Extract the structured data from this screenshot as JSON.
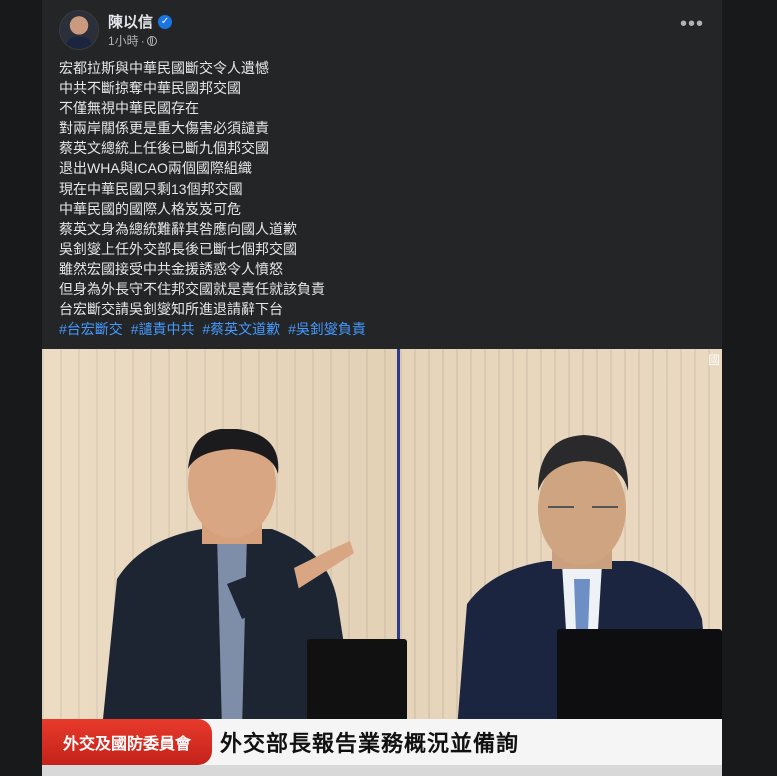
{
  "post": {
    "author": "陳以信",
    "time": "1小時",
    "separator": "·",
    "more_label": "•••",
    "verified_mark": "✓",
    "lines": [
      "宏都拉斯與中華民國斷交令人遺憾",
      "中共不斷掠奪中華民國邦交國",
      "不僅無視中華民國存在",
      "對兩岸關係更是重大傷害必須譴責",
      "蔡英文總統上任後已斷九個邦交國",
      "退出WHA與ICAO兩個國際組織",
      "現在中華民國只剩13個邦交國",
      "中華民國的國際人格岌岌可危",
      "蔡英文身為總統難辭其咎應向國人道歉",
      "吳釗燮上任外交部長後已斷七個邦交國",
      "雖然宏國接受中共金援誘惑令人憤怒",
      "但身為外長守不住邦交國就是責任就該負責",
      "台宏斷交請吳釗燮知所進退請辭下台"
    ],
    "hashtags": [
      "#台宏斷交",
      "#譴責中共",
      "#蔡英文道歉",
      "#吳釗燮負責"
    ]
  },
  "photo": {
    "caption_tag": "外交及國防委員會",
    "caption_text": "外交部長報告業務概況並備詢",
    "corner_logo": "國"
  },
  "colors": {
    "background": "#18191a",
    "card": "#242526",
    "text": "#e4e6eb",
    "secondary": "#b0b3b8",
    "link": "#4599ff",
    "caption_red": "#e73a2c"
  }
}
